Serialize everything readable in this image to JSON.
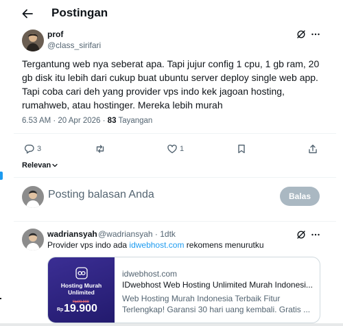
{
  "header": {
    "title": "Postingan"
  },
  "post": {
    "author_name": "prof",
    "author_handle": "@class_sirifari",
    "text": "Tergantung web nya seberat apa. Tapi jujur config 1 cpu, 1 gb ram, 20 gb disk itu lebih dari cukup buat ubuntu server deploy single web app. Tapi coba cari deh yang provider vps indo kek jagoan hosting, rumahweb, atau hostinger. Mereka lebih murah",
    "timestamp": "6.53 AM · 20 Apr 2026 · ",
    "views_count": "83",
    "views_label": " Tayangan"
  },
  "actions": {
    "reply_count": "3",
    "like_count": "1"
  },
  "sort": {
    "label": "Relevan"
  },
  "reply_box": {
    "placeholder": "Posting balasan Anda",
    "button_label": "Balas"
  },
  "reply": {
    "author_name": "wadriansyah",
    "author_handle": "@wadriansyah · 1dtk",
    "text_before": "Provider vps indo ada ",
    "link_text": "idwebhost.com",
    "text_after": " rekomens menurutku",
    "card": {
      "image_title_line1": "Hosting Murah",
      "image_title_line2": "Unlimited",
      "old_price": "Rp99.900",
      "currency": "Rp",
      "price": "19.900",
      "domain": "idwebhost.com",
      "title": "IDwebhost Web Hosting Unlimited Murah Indonesi...",
      "description": "Web Hosting Murah Indonesia Terbaik Fitur Terlengkap! Garansi 30 hari uang kembali. Gratis ..."
    }
  },
  "colors": {
    "accent": "#1d9bf0",
    "text_primary": "#0f1419",
    "text_secondary": "#536471",
    "button_disabled": "#aab8c2",
    "card_image_bg": "#2e2380"
  },
  "icons": {
    "back": "arrow-left-icon",
    "grok": "grok-icon",
    "more": "more-horizontal-icon",
    "reply": "reply-icon",
    "repost": "repost-icon",
    "like": "like-icon",
    "bookmark": "bookmark-icon",
    "share": "share-icon",
    "chevron": "chevron-down-icon"
  }
}
